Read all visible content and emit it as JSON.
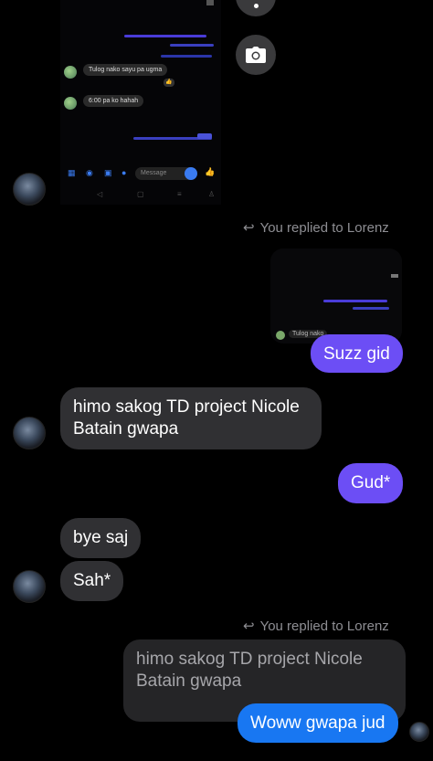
{
  "shared_screenshot": {
    "bubble1": "Tulog nako sayu pa ugma",
    "bubble2": "6:00 pa ko hahah",
    "input_placeholder": "Message"
  },
  "reply_header_1": "You replied to Lorenz",
  "thumbnail_bubble": "Tulog nako",
  "messages": {
    "m1": "Suzz gid",
    "m2": "himo sakog TD project Nicole Batain gwapa",
    "m3": "Gud*",
    "m4": "bye saj",
    "m5": "Sah*"
  },
  "reply_header_2": "You replied to Lorenz",
  "quoted_message": "himo sakog TD project Nicole Batain gwapa",
  "reply_message": "Woww gwapa jud",
  "colors": {
    "background": "#000000",
    "received_bubble": "#303033",
    "sent_purple": "#6c4ef5",
    "sent_blue": "#1877f2",
    "muted_text": "#8e8e93"
  }
}
